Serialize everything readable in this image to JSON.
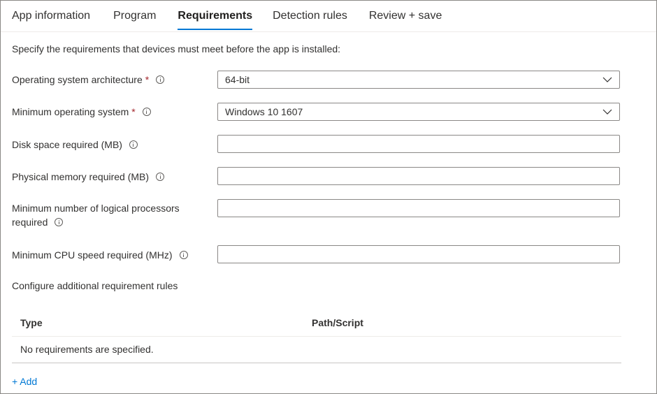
{
  "tabs": [
    {
      "label": "App information"
    },
    {
      "label": "Program"
    },
    {
      "label": "Requirements"
    },
    {
      "label": "Detection rules"
    },
    {
      "label": "Review + save"
    }
  ],
  "intro": "Specify the requirements that devices must meet before the app is installed:",
  "fields": {
    "os_arch": {
      "label": "Operating system architecture",
      "required_mark": "*",
      "value": "64-bit"
    },
    "min_os": {
      "label": "Minimum operating system",
      "required_mark": "*",
      "value": "Windows 10 1607"
    },
    "disk_space": {
      "label": "Disk space required (MB)",
      "value": ""
    },
    "physical_memory": {
      "label": "Physical memory required (MB)",
      "value": ""
    },
    "logical_processors": {
      "label": "Minimum number of logical processors required",
      "value": ""
    },
    "cpu_speed": {
      "label": "Minimum CPU speed required (MHz)",
      "value": ""
    }
  },
  "additional_rules": {
    "label": "Configure additional requirement rules",
    "columns": [
      "Type",
      "Path/Script"
    ],
    "empty_message": "No requirements are specified.",
    "add_label": "+ Add"
  },
  "colors": {
    "accent": "#0078d4",
    "required": "#a4262c",
    "border": "#8a8886"
  },
  "icons": {
    "info": "info-icon",
    "dropdown": "chevron-down-icon"
  }
}
